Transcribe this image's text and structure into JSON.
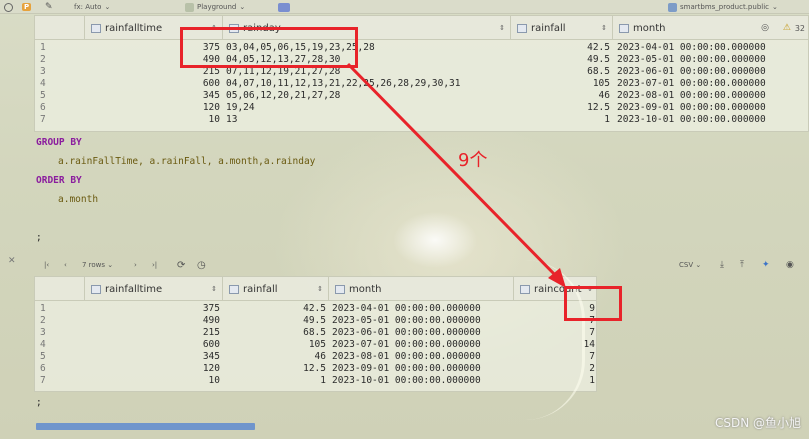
{
  "toolbar": {
    "letter_badge": "P",
    "fx_label": "fx: Auto",
    "schema_label": "Playground",
    "connection": "smartbms_product.public"
  },
  "top_grid": {
    "columns": [
      "rainfalltime",
      "rainday",
      "rainfall",
      "month"
    ],
    "warnings": "32",
    "rows": [
      {
        "n": "1",
        "rainfalltime": "375",
        "rainday": "03,04,05,06,15,19,23,25,28",
        "rainfall": "42.5",
        "month": "2023-04-01 00:00:00.000000"
      },
      {
        "n": "2",
        "rainfalltime": "490",
        "rainday": "04,05,12,13,27,28,30",
        "rainfall": "49.5",
        "month": "2023-05-01 00:00:00.000000"
      },
      {
        "n": "3",
        "rainfalltime": "215",
        "rainday": "07,11,12,19,21,27,28",
        "rainfall": "68.5",
        "month": "2023-06-01 00:00:00.000000"
      },
      {
        "n": "4",
        "rainfalltime": "600",
        "rainday": "04,07,10,11,12,13,21,22,25,26,28,29,30,31",
        "rainfall": "105",
        "month": "2023-07-01 00:00:00.000000"
      },
      {
        "n": "5",
        "rainfalltime": "345",
        "rainday": "05,06,12,20,21,27,28",
        "rainfall": "46",
        "month": "2023-08-01 00:00:00.000000"
      },
      {
        "n": "6",
        "rainfalltime": "120",
        "rainday": "19,24",
        "rainfall": "12.5",
        "month": "2023-09-01 00:00:00.000000"
      },
      {
        "n": "7",
        "rainfalltime": "10",
        "rainday": "13",
        "rainfall": "1",
        "month": "2023-10-01 00:00:00.000000"
      }
    ]
  },
  "sql": {
    "group_by": "GROUP BY",
    "group_cols": "a.rainFallTime, a.rainFall, a.month,a.rainday",
    "order_by": "ORDER BY",
    "order_col": "a.month",
    "terminator": ";"
  },
  "result_toolbar": {
    "rows_label": "7 rows",
    "export": "CSV"
  },
  "bottom_grid": {
    "columns": [
      "rainfalltime",
      "rainfall",
      "month",
      "raincount"
    ],
    "rows": [
      {
        "n": "1",
        "rainfalltime": "375",
        "rainfall": "42.5",
        "month": "2023-04-01 00:00:00.000000",
        "raincount": "9"
      },
      {
        "n": "2",
        "rainfalltime": "490",
        "rainfall": "49.5",
        "month": "2023-05-01 00:00:00.000000",
        "raincount": "7"
      },
      {
        "n": "3",
        "rainfalltime": "215",
        "rainfall": "68.5",
        "month": "2023-06-01 00:00:00.000000",
        "raincount": "7"
      },
      {
        "n": "4",
        "rainfalltime": "600",
        "rainfall": "105",
        "month": "2023-07-01 00:00:00.000000",
        "raincount": "14"
      },
      {
        "n": "5",
        "rainfalltime": "345",
        "rainfall": "46",
        "month": "2023-08-01 00:00:00.000000",
        "raincount": "7"
      },
      {
        "n": "6",
        "rainfalltime": "120",
        "rainfall": "12.5",
        "month": "2023-09-01 00:00:00.000000",
        "raincount": "2"
      },
      {
        "n": "7",
        "rainfalltime": "10",
        "rainfall": "1",
        "month": "2023-10-01 00:00:00.000000",
        "raincount": "1"
      }
    ]
  },
  "trailing_terminator": ";",
  "annotation": {
    "label": "9个",
    "color": "#e8232a"
  },
  "watermark": "CSDN @鱼小旭"
}
